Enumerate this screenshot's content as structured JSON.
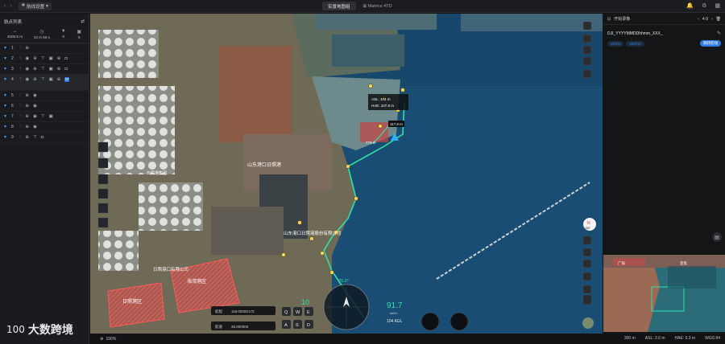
{
  "topbar": {
    "flight_label": "航线设置",
    "tabs": [
      {
        "label": "实景地图组",
        "active": true
      },
      {
        "label": "Matrice 4TD",
        "active": false
      }
    ]
  },
  "left_panel": {
    "title": "航点列表",
    "stats": [
      {
        "icon": "distance-icon",
        "value": "4005.5 m"
      },
      {
        "icon": "clock-icon",
        "value": "10 m 55 s"
      },
      {
        "icon": "waypoint-icon",
        "value": "9"
      },
      {
        "icon": "photo-icon",
        "value": "5"
      }
    ],
    "waypoints": [
      {
        "num": "1"
      },
      {
        "num": "2"
      },
      {
        "num": "3"
      },
      {
        "num": "4",
        "selected": true
      },
      {
        "num": "5"
      },
      {
        "num": "6"
      },
      {
        "num": "7"
      },
      {
        "num": "8"
      },
      {
        "num": "9"
      }
    ]
  },
  "map": {
    "labels": {
      "poi1": "山东港口日照港",
      "poi2": "日照港集团",
      "poi3": "山东港口日照港股份有限公司",
      "poi4": "日照港口有限公司",
      "area1": "海湾港区",
      "area2": "日照港区",
      "asl": "ASL: 104 m",
      "hae": "HAE: 107.8 m",
      "wp_dist": "117.8 m",
      "seg": "779 m",
      "angle": "25.2°",
      "speed": "91.7",
      "speed_unit": "km/h",
      "alt": "104 AGL",
      "ten": "10"
    },
    "gimbal_rows": [
      {
        "label": "航程",
        "value": "119.00000173"
      },
      {
        "label": "航速",
        "value": "35.000000"
      }
    ],
    "wasd": [
      "Q",
      "W",
      "E",
      "A",
      "S",
      "D"
    ],
    "compass_label": "N",
    "heading": "280°"
  },
  "right_panel": {
    "title": "开始录像",
    "pager": "4-9",
    "filename": "DJI_YYYYMMDDhhmm_XXX_",
    "tags": [
      "M4TD",
      "4D4TD"
    ],
    "action": "跳转航线"
  },
  "inset": {
    "labels": [
      "广角",
      "变焦"
    ]
  },
  "status": {
    "zoom": "100%",
    "scale": "300 m",
    "asl": "ASL: 2.6 m",
    "hae": "HAE: 6.3 m",
    "wgs": "WGS 84"
  },
  "brand": {
    "logo": "100",
    "name": "大数跨境"
  }
}
